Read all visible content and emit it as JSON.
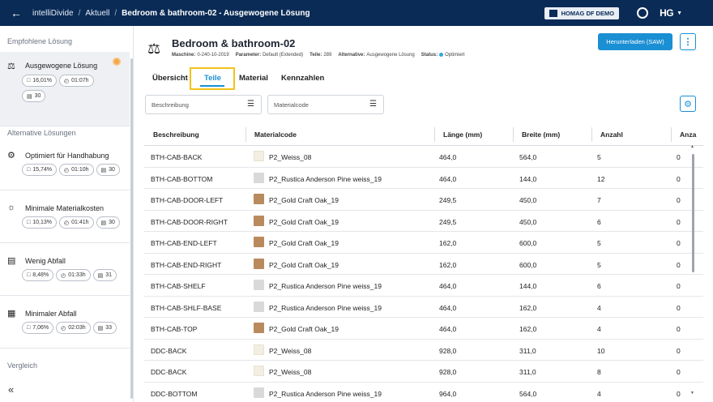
{
  "topbar": {
    "app_name": "intelliDivide",
    "crumb_current": "Aktuell",
    "crumb_page": "Bedroom & bathroom-02 - Ausgewogene Lösung",
    "account": "HOMAG DF DEMO",
    "logo": "HG"
  },
  "sidebar": {
    "recommended_title": "Empfohlene Lösung",
    "alternatives_title": "Alternative Lösungen",
    "compare_title": "Vergleich",
    "recommended": {
      "name": "Ausgewogene Lösung",
      "waste": "16,01%",
      "time": "01:07h",
      "boards": "30",
      "icon": "scale-icon"
    },
    "alternatives": [
      {
        "name": "Optimiert für Handhabung",
        "waste": "15,74%",
        "time": "01:10h",
        "boards": "30",
        "icon": "handling-icon"
      },
      {
        "name": "Minimale Materialkosten",
        "waste": "10,13%",
        "time": "01:41h",
        "boards": "30",
        "icon": "cost-icon"
      },
      {
        "name": "Wenig Abfall",
        "waste": "8,48%",
        "time": "01:33h",
        "boards": "31",
        "icon": "bin-icon"
      },
      {
        "name": "Minimaler Abfall",
        "waste": "7,06%",
        "time": "02:03h",
        "boards": "33",
        "icon": "bins-icon"
      }
    ]
  },
  "header": {
    "title": "Bedroom & bathroom-02",
    "machine_label": "Maschine:",
    "machine": "0-240-10-2019",
    "param_label": "Parameter:",
    "param": "Default (Extended)",
    "parts_label": "Teile:",
    "parts": "289",
    "alt_label": "Alternative:",
    "alt": "Ausgewogene Lösung",
    "status_label": "Status:",
    "status": "Optimiert",
    "download": "Herunterladen (SAW)"
  },
  "tabs": [
    "Übersicht",
    "Teile",
    "Material",
    "Kennzahlen"
  ],
  "filters": {
    "desc_placeholder": "Beschreibung",
    "mat_placeholder": "Materialcode"
  },
  "columns": [
    "Beschreibung",
    "Materialcode",
    "Länge (mm)",
    "Breite (mm)",
    "Anzahl",
    "Anza"
  ],
  "colors": {
    "weiss": "#f2efe2",
    "rustica": "#d9d9d9",
    "oak": "#b98a5e"
  },
  "rows": [
    {
      "desc": "BTH-CAB-BACK",
      "mat": "P2_Weiss_08",
      "swatch": "weiss",
      "len": "464,0",
      "wid": "564,0",
      "qty": "5",
      "extra": "0"
    },
    {
      "desc": "BTH-CAB-BOTTOM",
      "mat": "P2_Rustica Anderson Pine weiss_19",
      "swatch": "rustica",
      "len": "464,0",
      "wid": "144,0",
      "qty": "12",
      "extra": "0"
    },
    {
      "desc": "BTH-CAB-DOOR-LEFT",
      "mat": "P2_Gold Craft Oak_19",
      "swatch": "oak",
      "len": "249,5",
      "wid": "450,0",
      "qty": "7",
      "extra": "0"
    },
    {
      "desc": "BTH-CAB-DOOR-RIGHT",
      "mat": "P2_Gold Craft Oak_19",
      "swatch": "oak",
      "len": "249,5",
      "wid": "450,0",
      "qty": "6",
      "extra": "0"
    },
    {
      "desc": "BTH-CAB-END-LEFT",
      "mat": "P2_Gold Craft Oak_19",
      "swatch": "oak",
      "len": "162,0",
      "wid": "600,0",
      "qty": "5",
      "extra": "0"
    },
    {
      "desc": "BTH-CAB-END-RIGHT",
      "mat": "P2_Gold Craft Oak_19",
      "swatch": "oak",
      "len": "162,0",
      "wid": "600,0",
      "qty": "5",
      "extra": "0"
    },
    {
      "desc": "BTH-CAB-SHELF",
      "mat": "P2_Rustica Anderson Pine weiss_19",
      "swatch": "rustica",
      "len": "464,0",
      "wid": "144,0",
      "qty": "6",
      "extra": "0"
    },
    {
      "desc": "BTH-CAB-SHLF-BASE",
      "mat": "P2_Rustica Anderson Pine weiss_19",
      "swatch": "rustica",
      "len": "464,0",
      "wid": "162,0",
      "qty": "4",
      "extra": "0"
    },
    {
      "desc": "BTH-CAB-TOP",
      "mat": "P2_Gold Craft Oak_19",
      "swatch": "oak",
      "len": "464,0",
      "wid": "162,0",
      "qty": "4",
      "extra": "0"
    },
    {
      "desc": "DDC-BACK",
      "mat": "P2_Weiss_08",
      "swatch": "weiss",
      "len": "928,0",
      "wid": "311,0",
      "qty": "10",
      "extra": "0"
    },
    {
      "desc": "DDC-BACK",
      "mat": "P2_Weiss_08",
      "swatch": "weiss",
      "len": "928,0",
      "wid": "311,0",
      "qty": "8",
      "extra": "0"
    },
    {
      "desc": "DDC-BOTTOM",
      "mat": "P2_Rustica Anderson Pine weiss_19",
      "swatch": "rustica",
      "len": "964,0",
      "wid": "564,0",
      "qty": "4",
      "extra": "0"
    }
  ]
}
